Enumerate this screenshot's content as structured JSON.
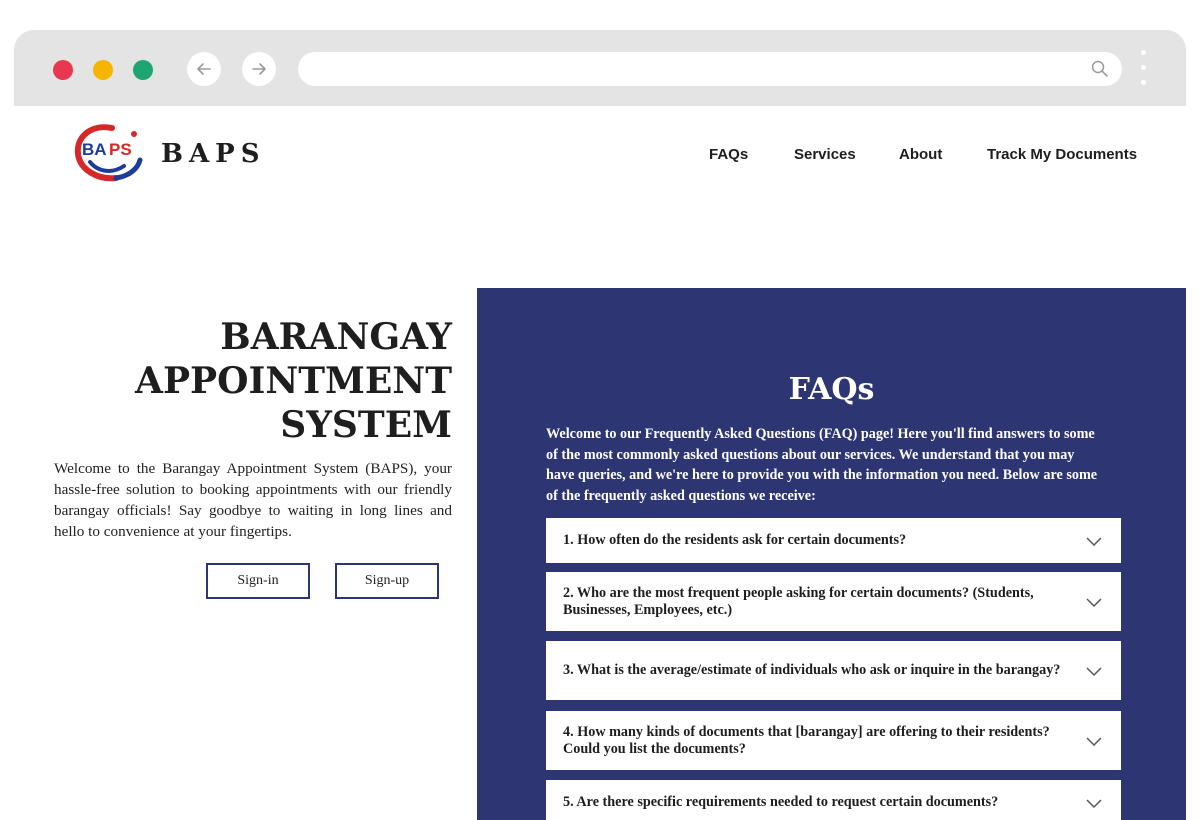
{
  "site": {
    "brand": "BAPS",
    "nav": [
      "FAQs",
      "Services",
      "About",
      "Track My Documents"
    ]
  },
  "hero": {
    "title_lines": [
      "BARANGAY",
      "APPOINTMENT",
      "SYSTEM"
    ],
    "description": "Welcome to the Barangay Appointment System (BAPS), your hassle-free solution to booking appointments with our friendly barangay officials! Say goodbye to waiting in long lines and hello to convenience at your fingertips.",
    "signin_label": "Sign-in",
    "signup_label": "Sign-up"
  },
  "faq": {
    "title": "FAQs",
    "intro": "Welcome to our Frequently Asked Questions (FAQ) page! Here you'll find answers to some of the most commonly asked questions about our services. We understand that you may have queries, and we're here to provide you with the information you need. Below are some of the frequently asked questions we receive:",
    "items": [
      "1. How often do the residents ask for certain documents?",
      "2. Who are the most frequent people asking for certain documents? (Students, Businesses, Employees, etc.)",
      "3. What is the average/estimate of individuals who ask or inquire in the barangay?",
      "4. How many kinds of documents that [barangay] are offering to their residents? Could you list the documents?",
      "5. Are there specific requirements needed to request certain documents?"
    ]
  },
  "colors": {
    "panel": "#2d3673",
    "dot_red": "#e8384f",
    "dot_yellow": "#f5b400",
    "dot_green": "#1ea672"
  },
  "icons": [
    "back-arrow-icon",
    "forward-arrow-icon",
    "search-icon",
    "more-icon",
    "chevron-down-icon"
  ]
}
